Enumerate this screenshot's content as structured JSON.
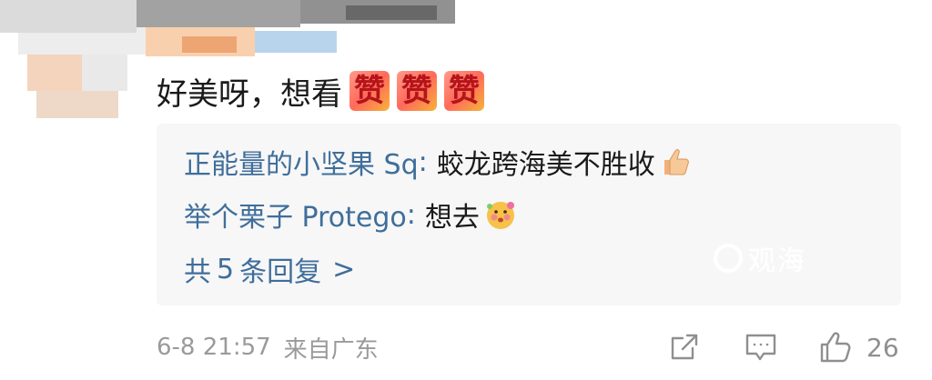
{
  "comment": {
    "text": "好美呀，想看",
    "emojis": [
      "赞",
      "赞",
      "赞"
    ]
  },
  "replies": [
    {
      "user": "正能量的小坚果 Sq",
      "text": "蛟龙跨海美不胜收",
      "emoji_name": "thumbs-up-icon"
    },
    {
      "user": "举个栗子 Protego",
      "text": "想去",
      "emoji_name": "blushing-face-icon"
    }
  ],
  "more_replies": {
    "prefix": "共",
    "count": "5",
    "suffix": "条回复",
    "arrow": ">"
  },
  "meta": {
    "time": "6-8 21:57",
    "location": "来自广东"
  },
  "actions": {
    "like_count": "26"
  },
  "watermark": "观海",
  "colors": {
    "link": "#3f6e9b",
    "meta_gray": "#9a9a9a",
    "reply_bg": "#f7f7f7"
  }
}
